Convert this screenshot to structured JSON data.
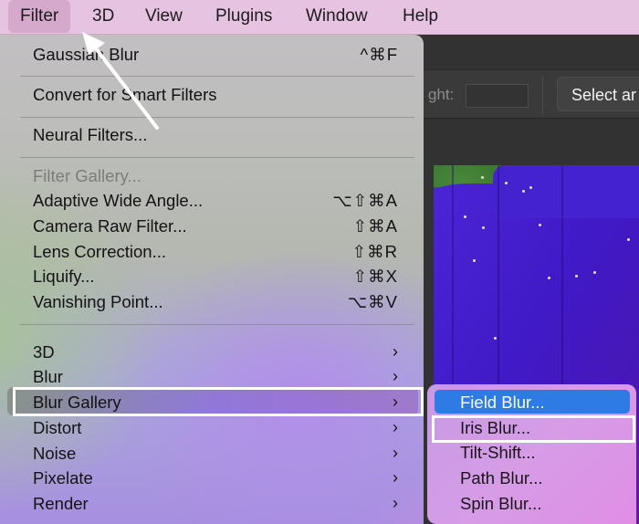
{
  "menubar": {
    "items": [
      {
        "label": "Filter",
        "active": true
      },
      {
        "label": "3D"
      },
      {
        "label": "View"
      },
      {
        "label": "Plugins"
      },
      {
        "label": "Window"
      },
      {
        "label": "Help"
      }
    ]
  },
  "options_bar": {
    "height_label": "ght:",
    "height_value": "",
    "select_button": "Select ar"
  },
  "filter_menu": {
    "items": [
      {
        "label": "Gaussian Blur",
        "shortcut": "^⌘F"
      },
      {
        "label": "Convert for Smart Filters"
      },
      {
        "label": "Neural Filters..."
      },
      {
        "label": "Filter Gallery...",
        "disabled": true
      },
      {
        "label": "Adaptive Wide Angle...",
        "shortcut": "⌥⇧⌘A"
      },
      {
        "label": "Camera Raw Filter...",
        "shortcut": "⇧⌘A"
      },
      {
        "label": "Lens Correction...",
        "shortcut": "⇧⌘R"
      },
      {
        "label": "Liquify...",
        "shortcut": "⇧⌘X"
      },
      {
        "label": "Vanishing Point...",
        "shortcut": "⌥⌘V"
      },
      {
        "label": "3D",
        "submenu": true
      },
      {
        "label": "Blur",
        "submenu": true
      },
      {
        "label": "Blur Gallery",
        "submenu": true,
        "highlighted": true
      },
      {
        "label": "Distort",
        "submenu": true
      },
      {
        "label": "Noise",
        "submenu": true
      },
      {
        "label": "Pixelate",
        "submenu": true
      },
      {
        "label": "Render",
        "submenu": true
      }
    ],
    "chevron": "›"
  },
  "blur_gallery_submenu": {
    "items": [
      {
        "label": "Field Blur...",
        "selected": true
      },
      {
        "label": "Iris Blur...",
        "callout": true
      },
      {
        "label": "Tilt-Shift..."
      },
      {
        "label": "Path Blur..."
      },
      {
        "label": "Spin Blur..."
      }
    ]
  },
  "colors": {
    "menubar_bg": "#e6c3e0",
    "selection_blue": "#2f7be6",
    "callout_border": "#ffffff"
  }
}
